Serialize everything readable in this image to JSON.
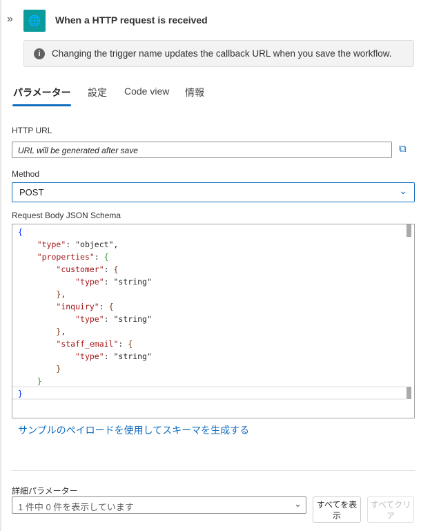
{
  "header": {
    "title": "When a HTTP request is received",
    "icon": "http-globe-icon"
  },
  "info": {
    "text": "Changing the trigger name updates the callback URL when you save the workflow."
  },
  "tabs": [
    {
      "label": "パラメーター",
      "active": true
    },
    {
      "label": "設定"
    },
    {
      "label": "Code view"
    },
    {
      "label": "情報"
    }
  ],
  "http_url": {
    "label": "HTTP URL",
    "value": "URL will be generated after save"
  },
  "method": {
    "label": "Method",
    "value": "POST"
  },
  "schema": {
    "label": "Request Body JSON Schema",
    "lines": [
      "{",
      "    \"type\": \"object\",",
      "    \"properties\": {",
      "        \"customer\": {",
      "            \"type\": \"string\"",
      "        },",
      "        \"inquiry\": {",
      "            \"type\": \"string\"",
      "        },",
      "        \"staff_email\": {",
      "            \"type\": \"string\"",
      "        }",
      "    }",
      "}"
    ]
  },
  "generate_link": "サンプルのペイロードを使用してスキーマを生成する",
  "advanced": {
    "label": "詳細パラメーター",
    "value": "1 件中 0 件を表示しています",
    "show_all": "すべてを表示",
    "clear_all": "すべてクリア"
  },
  "colors": {
    "accent": "#0f6cbd",
    "icon_bg": "#0a9c9c"
  }
}
